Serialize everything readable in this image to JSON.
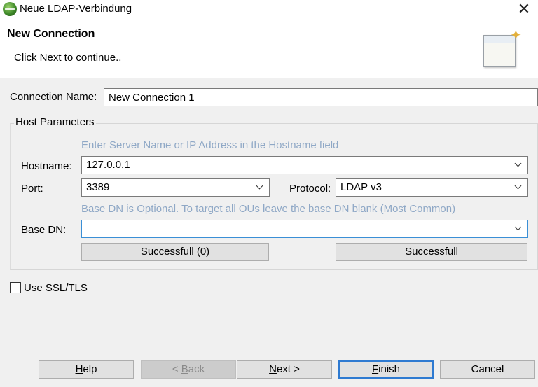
{
  "window": {
    "title": "Neue LDAP-Verbindung",
    "close_glyph": "✕"
  },
  "banner": {
    "title": "New Connection",
    "subtitle": "Click Next to continue..",
    "image_icon": "wizard-window-icon"
  },
  "connection": {
    "label": "Connection Name:",
    "value": "New Connection 1"
  },
  "host_params": {
    "legend": "Host Parameters",
    "hostname_hint": "Enter Server Name or IP Address in the Hostname field",
    "hostname_label": "Hostname:",
    "hostname_value": "127.0.0.1",
    "port_label": "Port:",
    "port_value": "3389",
    "protocol_label": "Protocol:",
    "protocol_value": "LDAP v3",
    "base_dn_hint": "Base DN is Optional. To target all OUs leave the base DN blank (Most Common)",
    "base_dn_label": "Base DN:",
    "base_dn_value": "",
    "test_left_label": "Successfull (0)",
    "test_right_label": "Successfull"
  },
  "ssl": {
    "label": "Use SSL/TLS",
    "checked": false
  },
  "footer": {
    "help": {
      "u": "H",
      "rest": "elp"
    },
    "back": {
      "pre": "< ",
      "u": "B",
      "rest": "ack"
    },
    "next": {
      "u": "N",
      "rest": "ext >"
    },
    "finish": {
      "u": "F",
      "rest": "inish"
    },
    "cancel": "Cancel"
  }
}
